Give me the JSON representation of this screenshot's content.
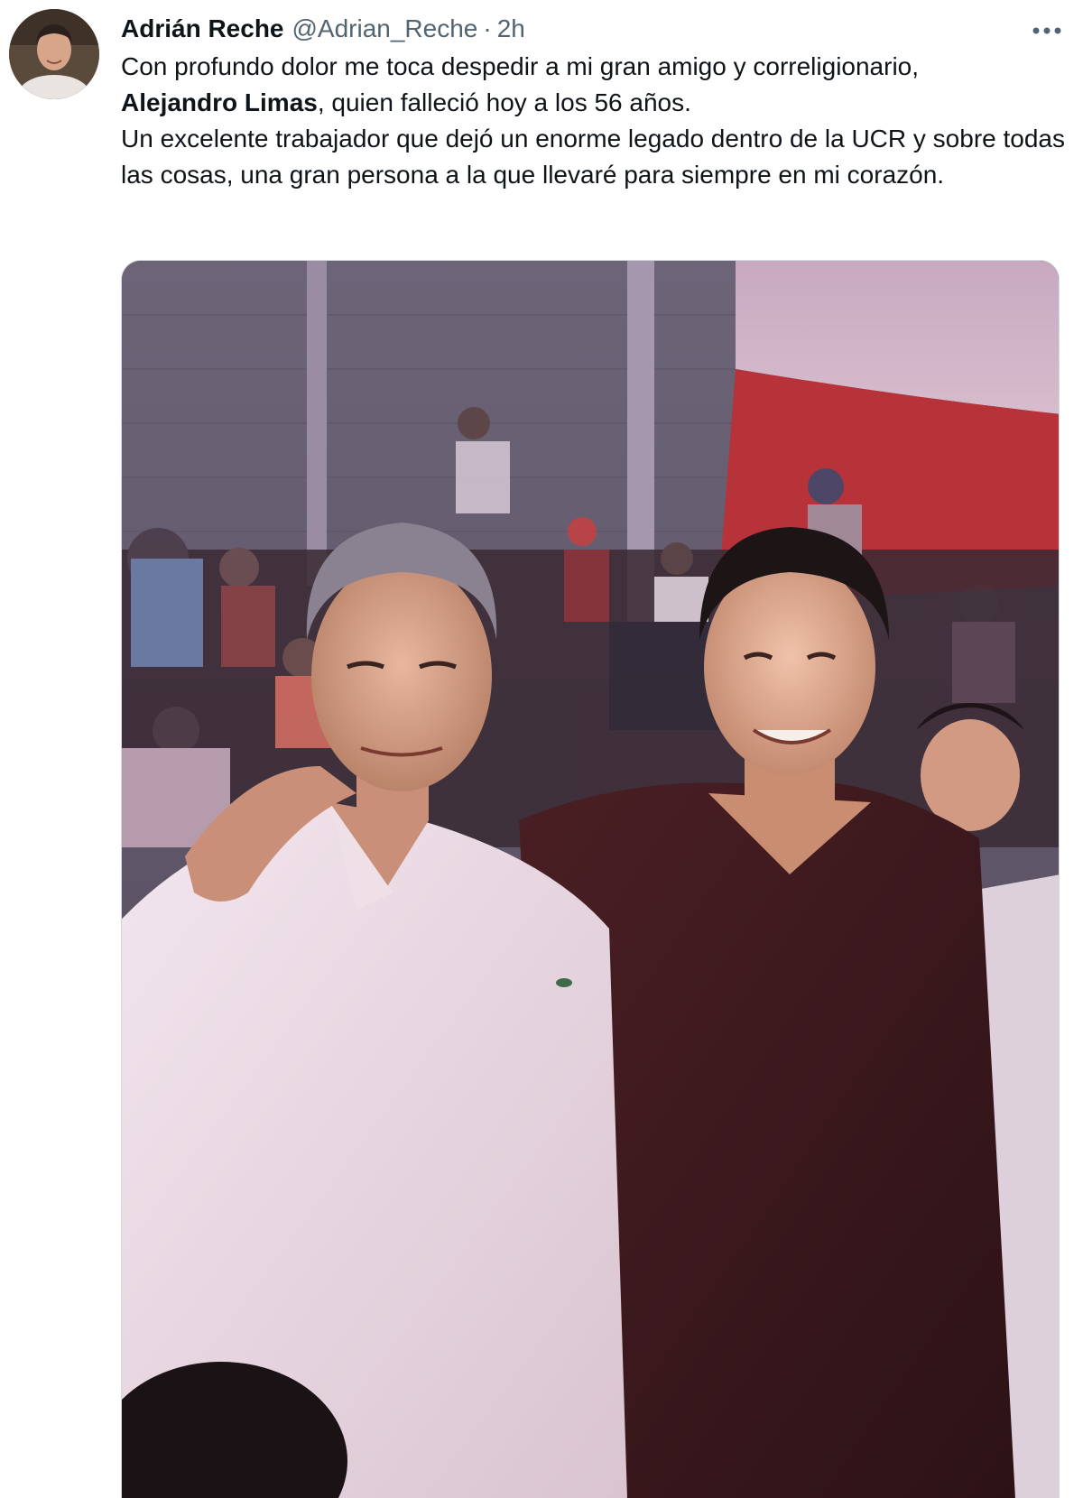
{
  "tweet": {
    "author": {
      "display_name": "Adrián Reche",
      "handle": "@Adrian_Reche",
      "separator": "·",
      "time": "2h"
    },
    "more_icon": "more-horizontal-icon",
    "text": {
      "line1": "Con profundo dolor me toca despedir a mi gran amigo y correligionario,",
      "mention_bold": "Alejandro Limas",
      "line2_rest": ", quien falleció hoy a los 56 años.",
      "line3": "Un excelente trabajador que dejó un enorme legado dentro de la UCR y sobre todas las cosas, una gran persona a la que llevaré para siempre en mi corazón."
    },
    "media": {
      "type": "photo"
    }
  },
  "colors": {
    "text_primary": "#0f1419",
    "text_secondary": "#536471",
    "border": "#cfd9de"
  }
}
